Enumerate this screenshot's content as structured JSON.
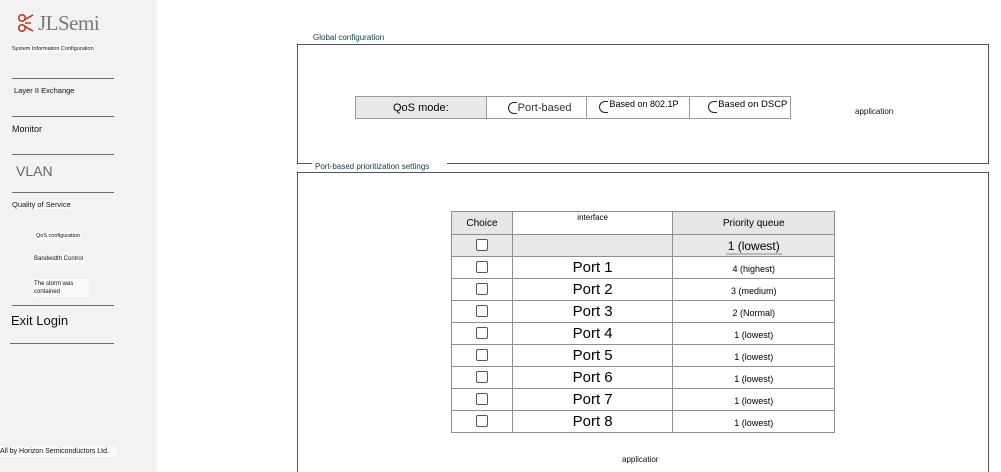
{
  "brand": {
    "logo_text": "JLSemi"
  },
  "sidebar": {
    "items": [
      {
        "label": "System Information Configuration"
      },
      {
        "label": "Layer II Exchange"
      },
      {
        "label": "Monitor"
      },
      {
        "label": "VLAN"
      },
      {
        "label": "Quality of Service"
      },
      {
        "label": "Exit Login"
      }
    ],
    "subitems": [
      {
        "label": "QoS configuration"
      },
      {
        "label": "Bandwidth Control"
      },
      {
        "label": "The storm was contained"
      }
    ],
    "footer": "All by Horizon Semiconductors Ltd."
  },
  "global_config": {
    "legend": "Global configuration",
    "qos_mode_label": "QoS mode:",
    "options": [
      {
        "label": "Port-based"
      },
      {
        "label": "Based on 802.1P"
      },
      {
        "label": "Based on DSCP"
      }
    ],
    "apply_label": "application"
  },
  "port_settings": {
    "legend": "Port-based prioritization settings",
    "headers": {
      "choice": "Choice",
      "interface": "interface",
      "queue": "Priority queue"
    },
    "global_row_queue": "1 (lowest)",
    "rows": [
      {
        "port": "Port 1",
        "queue": "4 (highest)"
      },
      {
        "port": "Port 2",
        "queue": "3 (medium)"
      },
      {
        "port": "Port 3",
        "queue": "2 (Normal)"
      },
      {
        "port": "Port 4",
        "queue": "1 (lowest)"
      },
      {
        "port": "Port 5",
        "queue": "1 (lowest)"
      },
      {
        "port": "Port 6",
        "queue": "1 (lowest)"
      },
      {
        "port": "Port 7",
        "queue": "1 (lowest)"
      },
      {
        "port": "Port 8",
        "queue": "1 (lowest)"
      }
    ],
    "apply_label": "applicatior"
  }
}
